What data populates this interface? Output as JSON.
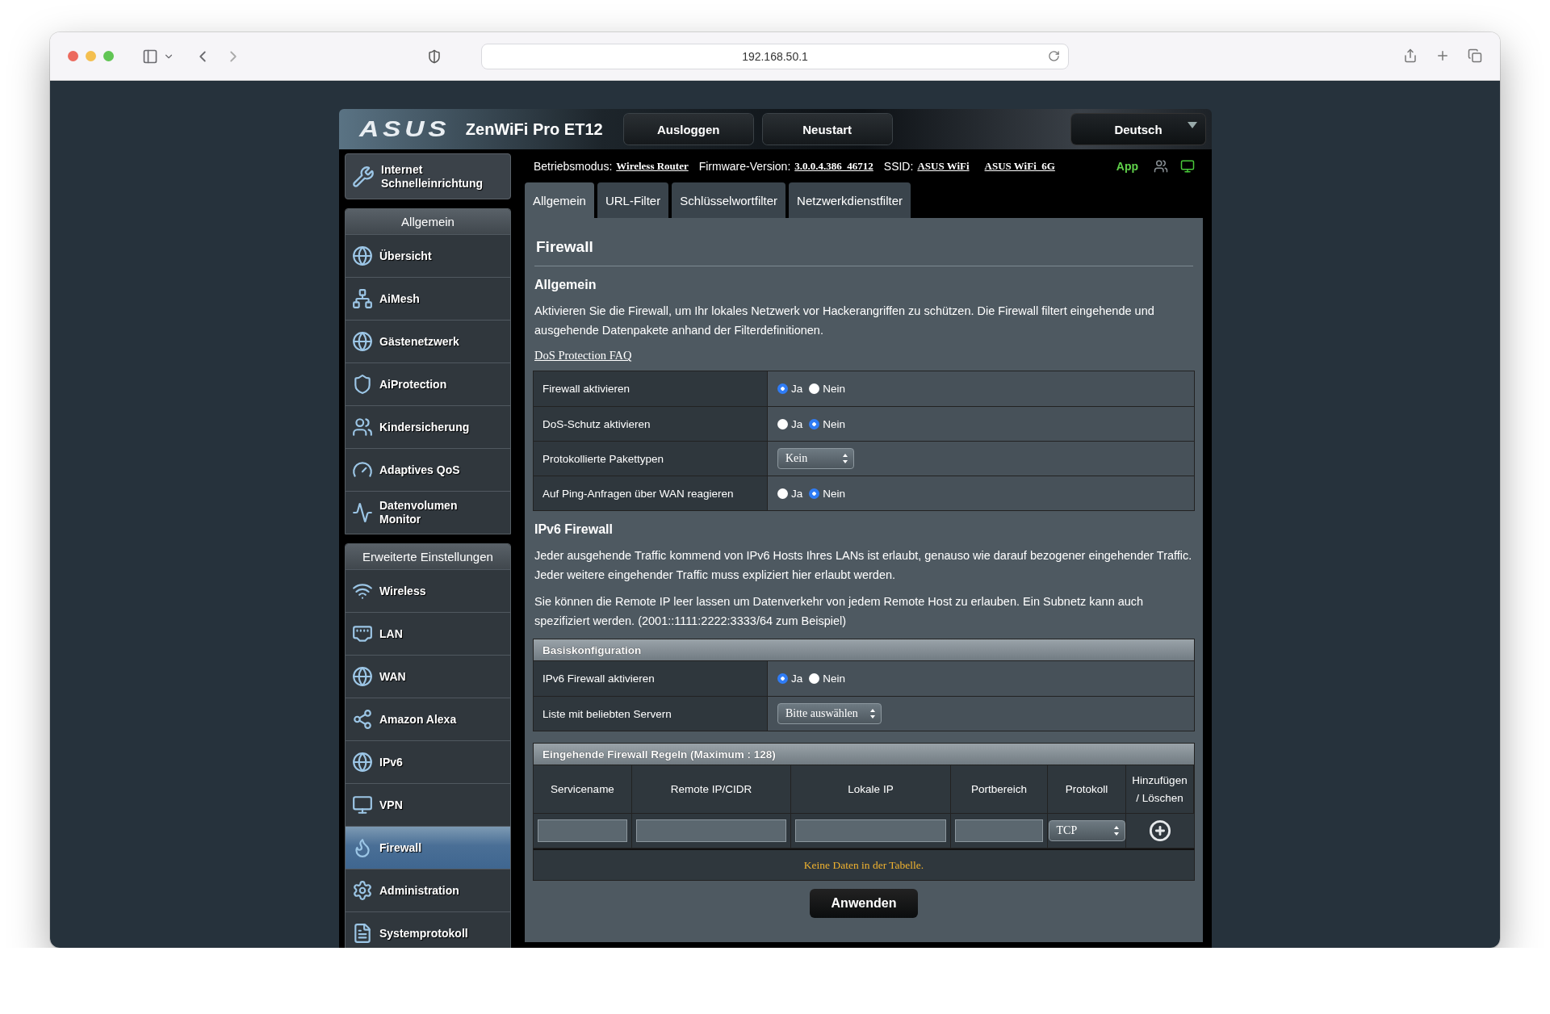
{
  "browser": {
    "url": "192.168.50.1"
  },
  "header": {
    "logo": "ASUS",
    "model": "ZenWiFi Pro ET12",
    "buttons": [
      "Ausloggen",
      "Neustart"
    ],
    "language": "Deutsch"
  },
  "status_line": {
    "mode_label": "Betriebsmodus:",
    "mode": "Wireless Router",
    "firmware_label": "Firmware-Version:",
    "firmware": "3.0.0.4.386_46712",
    "ssid_label": "SSID:",
    "ssids": [
      "ASUS WiFi",
      "ASUS WiFi_6G"
    ],
    "app": "App"
  },
  "tabs": [
    {
      "label": "Allgemein",
      "selected": true
    },
    {
      "label": "URL-Filter",
      "selected": false
    },
    {
      "label": "Schlüsselwortfilter",
      "selected": false
    },
    {
      "label": "Netzwerkdienstfilter",
      "selected": false
    }
  ],
  "sidebar": {
    "quick_setup": "Internet Schnelleinrichtung",
    "groups": [
      {
        "title": "Allgemein",
        "items": [
          {
            "label": "Übersicht",
            "selected": false
          },
          {
            "label": "AiMesh",
            "selected": false
          },
          {
            "label": "Gästenetzwerk",
            "selected": false
          },
          {
            "label": "AiProtection",
            "selected": false
          },
          {
            "label": "Kindersicherung",
            "selected": false
          },
          {
            "label": "Adaptives QoS",
            "selected": false
          },
          {
            "label": "Datenvolumen Monitor",
            "selected": false
          }
        ]
      },
      {
        "title": "Erweiterte Einstellungen",
        "items": [
          {
            "label": "Wireless",
            "selected": false
          },
          {
            "label": "LAN",
            "selected": false
          },
          {
            "label": "WAN",
            "selected": false
          },
          {
            "label": "Amazon Alexa",
            "selected": false
          },
          {
            "label": "IPv6",
            "selected": false
          },
          {
            "label": "VPN",
            "selected": false
          },
          {
            "label": "Firewall",
            "selected": true
          },
          {
            "label": "Administration",
            "selected": false
          },
          {
            "label": "Systemprotokoll",
            "selected": false
          }
        ]
      }
    ]
  },
  "content": {
    "title": "Firewall",
    "general": {
      "heading": "Allgemein",
      "description": "Aktivieren Sie die Firewall, um Ihr lokales Netzwerk vor Hackerangriffen zu schützen. Die Firewall filtert eingehende und ausgehende Datenpakete anhand der Filterdefinitionen.",
      "faq_link": "DoS Protection FAQ",
      "rows": [
        {
          "kind": "radio",
          "label": "Firewall aktivieren",
          "options": [
            {
              "label": "Ja",
              "selected": true
            },
            {
              "label": "Nein",
              "selected": false
            }
          ]
        },
        {
          "kind": "radio",
          "label": "DoS-Schutz aktivieren",
          "options": [
            {
              "label": "Ja",
              "selected": false
            },
            {
              "label": "Nein",
              "selected": true
            }
          ]
        },
        {
          "kind": "select",
          "label": "Protokollierte Pakettypen",
          "value": "Kein"
        },
        {
          "kind": "radio",
          "label": "Auf Ping-Anfragen über WAN reagieren",
          "options": [
            {
              "label": "Ja",
              "selected": false
            },
            {
              "label": "Nein",
              "selected": true
            }
          ]
        }
      ]
    },
    "ipv6": {
      "heading": "IPv6 Firewall",
      "paragraphs": [
        "Jeder ausgehende Traffic kommend von IPv6 Hosts Ihres LANs ist erlaubt, genauso wie darauf bezogener eingehender Traffic. Jeder weitere eingehender Traffic muss expliziert hier erlaubt werden.",
        "Sie können die Remote IP leer lassen um Datenverkehr von jedem Remote Host zu erlauben. Ein Subnetz kann auch spezifiziert werden. (2001::1111:2222:3333/64 zum Beispiel)"
      ],
      "basic": {
        "title": "Basiskonfiguration",
        "rows": [
          {
            "kind": "radio",
            "label": "IPv6 Firewall aktivieren",
            "options": [
              {
                "label": "Ja",
                "selected": true
              },
              {
                "label": "Nein",
                "selected": false
              }
            ]
          },
          {
            "kind": "select",
            "label": "Liste mit beliebten Servern",
            "value": "Bitte auswählen"
          }
        ]
      },
      "rules": {
        "title": "Eingehende Firewall Regeln (Maximum : 128)",
        "columns": [
          "Servicename",
          "Remote IP/CIDR",
          "Lokale IP",
          "Portbereich",
          "Protokoll",
          "Hinzufügen / Löschen"
        ],
        "protocol": "TCP",
        "empty_message": "Keine Daten in der Tabelle."
      }
    },
    "apply_button": "Anwenden"
  }
}
